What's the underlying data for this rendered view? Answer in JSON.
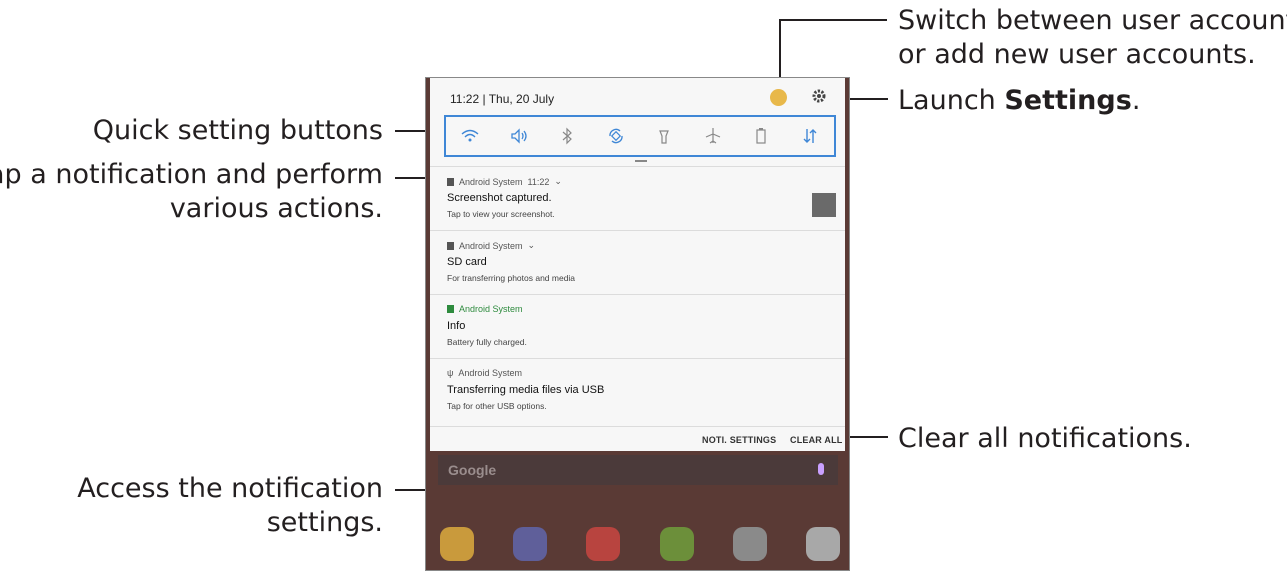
{
  "callouts": {
    "user_accounts": "Switch between user accounts",
    "user_accounts_2": "or add new user accounts.",
    "launch_prefix": "Launch ",
    "launch_settings": "Settings",
    "launch_suffix": ".",
    "quick_settings": "Quick setting buttons",
    "tap_notification_1": "Tap a notification and perform",
    "tap_notification_2": "various actions.",
    "clear_all": "Clear all notifications.",
    "access_settings_1": "Access the notification",
    "access_settings_2": "settings."
  },
  "status": {
    "time": "11:22 | Thu, 20 July"
  },
  "quick_settings": [
    {
      "icon": "wifi-icon"
    },
    {
      "icon": "sound-icon"
    },
    {
      "icon": "bluetooth-icon"
    },
    {
      "icon": "auto-rotate-icon"
    },
    {
      "icon": "flashlight-icon"
    },
    {
      "icon": "airplane-mode-icon"
    },
    {
      "icon": "power-saving-icon"
    },
    {
      "icon": "mobile-data-icon"
    }
  ],
  "notifications": [
    {
      "app": "Android System",
      "time": "11:22",
      "title": "Screenshot captured.",
      "text": "Tap to view your screenshot."
    },
    {
      "app": "Android System",
      "title": "SD card",
      "text": "For transferring photos and media"
    },
    {
      "app": "Android System",
      "title": "Info",
      "text": "Battery fully charged."
    },
    {
      "app": "Android System",
      "title": "Transferring media files via USB",
      "text": "Tap for other USB options."
    }
  ],
  "actions": {
    "noti_settings": "NOTI. SETTINGS",
    "clear_all": "CLEAR ALL"
  },
  "home": {
    "search_logo": "Google"
  },
  "colors": {
    "accent": "#3f87d6",
    "green": "#2e8b3e",
    "wallpaper": "#5a3a35"
  }
}
